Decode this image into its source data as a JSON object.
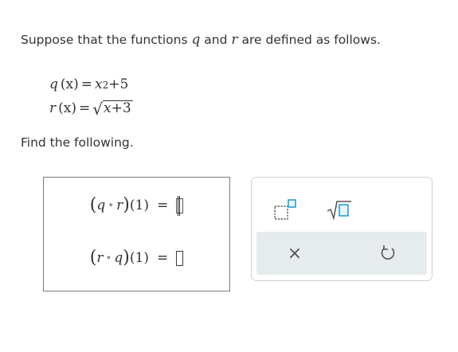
{
  "problem": {
    "prompt_start": "Suppose that the functions",
    "var_q": "q",
    "prompt_and": "and",
    "var_r": "r",
    "prompt_end": "are defined as follows."
  },
  "definitions": {
    "q": {
      "lhs": "q",
      "arg": "(x)",
      "eq": "=",
      "base": "x",
      "exp": "2",
      "tail": "+5"
    },
    "r": {
      "lhs": "r",
      "arg": "(x)",
      "eq": "=",
      "radicand_var": "x",
      "radicand_tail": "+3"
    }
  },
  "find_label": "Find the following.",
  "answers": [
    {
      "outer": "q",
      "inner": "r",
      "compose": "∘",
      "arg": "(1)",
      "eq": "=",
      "value": "",
      "focused": true
    },
    {
      "outer": "r",
      "inner": "q",
      "compose": "∘",
      "arg": "(1)",
      "eq": "=",
      "value": "",
      "focused": false
    }
  ],
  "toolbar": {
    "superscript_icon": "superscript-icon",
    "sqrt_icon": "sqrt-icon",
    "clear_icon": "x-icon",
    "undo_icon": "undo-icon",
    "clear_symbol": "×",
    "accent_color": "#2e9fcf",
    "icon_color": "#555555",
    "action_bg": "#e6ebee"
  }
}
